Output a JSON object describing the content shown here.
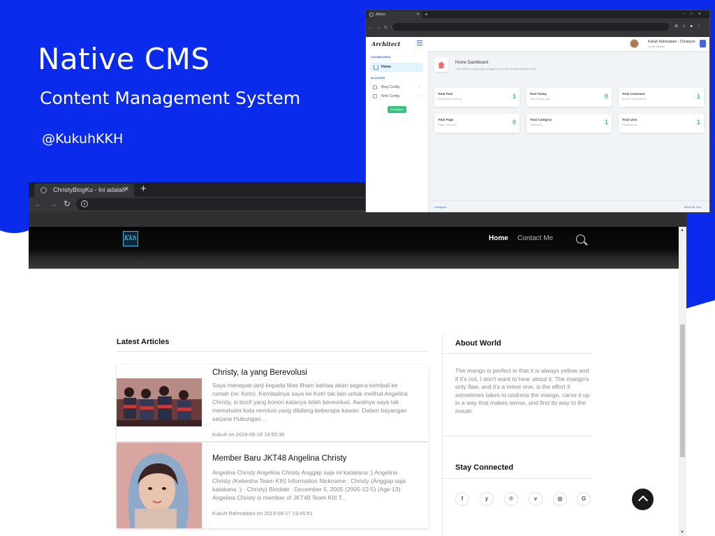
{
  "promo": {
    "title": "Native CMS",
    "subtitle": "Content Management System",
    "handle": "@KukuhKKH",
    "bg_color": "#0a2bec"
  },
  "admin": {
    "tab_title": "Admin",
    "new_tab": "+",
    "logo": "Architect",
    "user_name": "Kukuh Rahmadani - Christyzer",
    "user_role": "Co-ler Master",
    "sidebar": {
      "section_dashboards": "DASHBOARDS",
      "home": "Home",
      "section_blogger": "BLOGGER",
      "blog_config": "Blog Config",
      "web_config": "Web Config",
      "button": "Christyzer"
    },
    "dashboard": {
      "title": "Home Dashboard",
      "subtitle": "Hallo Admin yang borjuk, jangan lupa untuk mempermudah hidup"
    },
    "cards": [
      {
        "title": "Total Post",
        "sub": "Dependable ide mu",
        "value": "1"
      },
      {
        "title": "Post Today",
        "sub": "Hari ini ada apa",
        "value": "0"
      },
      {
        "title": "Total Comment",
        "sub": "Indah Pengemarmu",
        "value": "1"
      },
      {
        "title": "Total Page",
        "sub": "Page Immesive",
        "value": "0"
      },
      {
        "title": "Total Category",
        "sub": "Pilihanmu",
        "value": "1"
      },
      {
        "title": "Total User",
        "sub": "Pegawai Mu",
        "value": "1"
      }
    ],
    "footer_left": "Instagram",
    "footer_right": "Mbuh Ak Oyo",
    "accent": "#3f6ad8",
    "green": "#3ac47d"
  },
  "blog": {
    "tab_title": "ChristyBlogKu - Ini adalah web p",
    "new_tab": "+",
    "logo": "Kkh",
    "nav": {
      "home": "Home",
      "contact": "Contact Me"
    },
    "latest_heading": "Latest Articles",
    "articles": [
      {
        "title": "Christy, Ia yang Berevolusi",
        "excerpt": "Saya menepati janji kepada Mas Ilham bahwa akan segera kembali ke rumah (re: Ketri). Kembalinya saya ke Ketri tak lain untuk melihat Angelina Christy, si bocil yang konon katanya telah berevolusi. Awalnya saya tak memahami kata revolusi yang dibilang beberapa kawan. Dalam bayangan sarjana Hubungan...",
        "meta": "Kukuh on 2019-08-18 19:50:36"
      },
      {
        "title": "Member Baru JKT48 Angelina Christy",
        "excerpt": "Angelina Christy Angelina Christy Anggap saja ini katakana :) Angelina Christy (Kebesha Team KIII) Information Nickname : Christy (Anggap saja katakana :) - Christy) Birtdate : December 5, 2005 (2005-12-5) (Age 13) Angelina Christy is member of JKT48 Team KIII T...",
        "meta": "Kukuh Rahmadani on 2019-08-17 19:45:51"
      }
    ],
    "about_heading": "About World",
    "about_text": "The mango is perfect in that it is always yellow and if it's not, I don't want to hear about it. The mango's only flaw, and it's a minor one, is the effort it sometimes takes to undress the mango, carve it up in a way that makes sense, and find its way to the mouth.",
    "stay_heading": "Stay Connected",
    "social": [
      {
        "icon": "facebook-icon",
        "glyph": "f"
      },
      {
        "icon": "twitter-icon",
        "glyph": "y"
      },
      {
        "icon": "pinterest-icon",
        "glyph": "℗"
      },
      {
        "icon": "vimeo-icon",
        "glyph": "v"
      },
      {
        "icon": "instagram-icon",
        "glyph": "◎"
      },
      {
        "icon": "google-icon",
        "glyph": "G"
      }
    ]
  }
}
